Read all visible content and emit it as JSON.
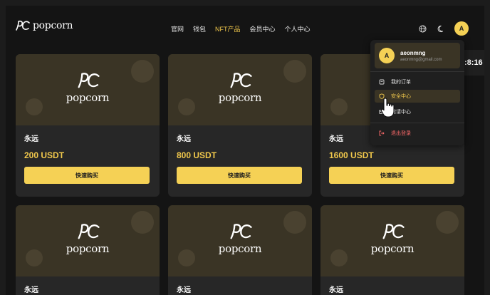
{
  "header": {
    "logo_text": "popcorn",
    "nav": [
      "官网",
      "钱包",
      "NFT产品",
      "会员中心",
      "个人中心"
    ],
    "active_nav": 2,
    "avatar_letter": "A"
  },
  "brand_text": "popcorn",
  "cards": [
    {
      "term": "永远",
      "price": "200 USDT",
      "button": "快速购买"
    },
    {
      "term": "永远",
      "price": "800 USDT",
      "button": "快速购买"
    },
    {
      "term": "永远",
      "price": "1600 USDT",
      "button": "快速购买"
    },
    {
      "term": "永远",
      "price": "",
      "button": ""
    },
    {
      "term": "永远",
      "price": "",
      "button": ""
    },
    {
      "term": "永远",
      "price": "",
      "button": ""
    }
  ],
  "menu": {
    "avatar_letter": "A",
    "username": "aeonmng",
    "email": "aeonmng@gmail.com",
    "items": [
      {
        "label": "我的订单",
        "icon": "order-icon"
      },
      {
        "label": "安全中心",
        "icon": "shield-icon"
      },
      {
        "label": "邀请中心",
        "icon": "invite-icon"
      },
      {
        "label": "退出登录",
        "icon": "logout-icon"
      }
    ]
  },
  "time_fragment": ":8:16",
  "colors": {
    "accent": "#f5d155",
    "background": "#141414",
    "card": "#272727",
    "logout": "#ff6b6b"
  }
}
